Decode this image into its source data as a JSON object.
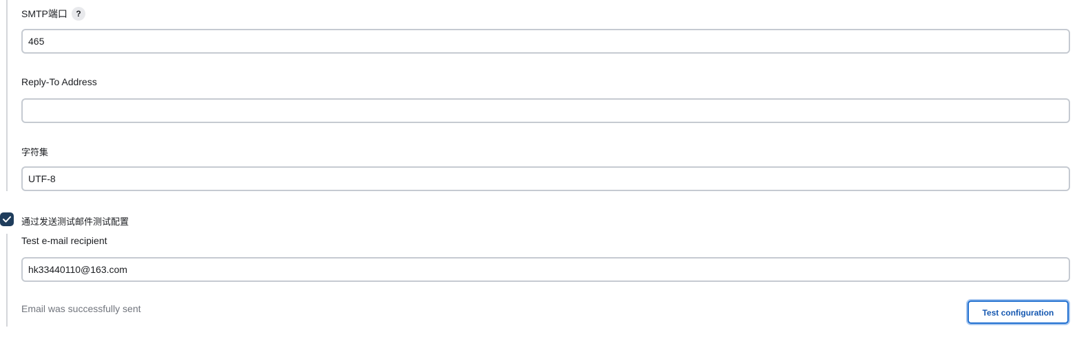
{
  "smtp_port": {
    "label": "SMTP端口",
    "help": "?",
    "value": "465"
  },
  "reply_to": {
    "label": "Reply-To Address",
    "value": ""
  },
  "charset": {
    "label": "字符集",
    "value": "UTF-8"
  },
  "test_toggle": {
    "checked": true,
    "label": "通过发送测试邮件测试配置"
  },
  "test_recipient": {
    "label": "Test e-mail recipient",
    "value": "hk33440110@163.com"
  },
  "status_message": "Email was successfully sent",
  "test_button_label": "Test configuration",
  "colors": {
    "accent": "#1f6fd0",
    "checkbox": "#1f3d5c",
    "border": "#c5cad1",
    "muted_text": "#70747c"
  }
}
